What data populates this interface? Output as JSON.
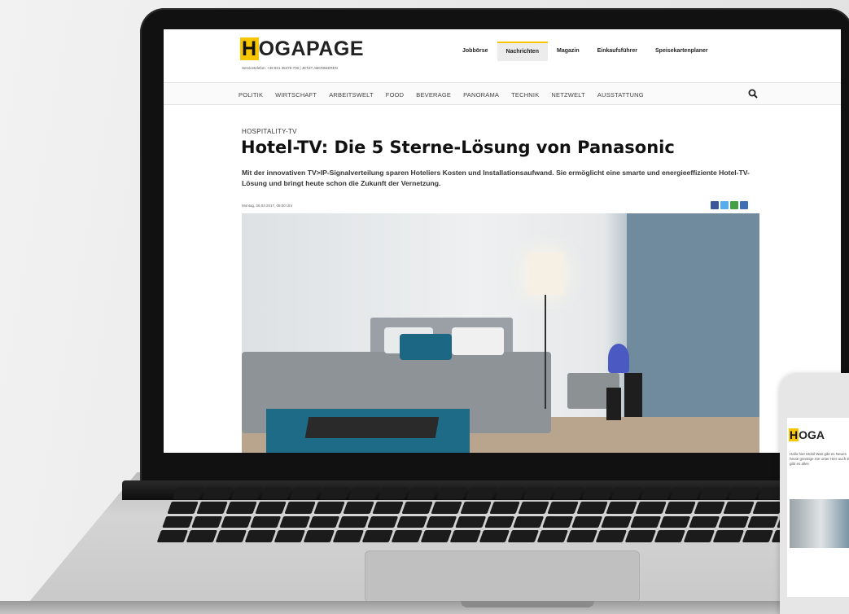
{
  "site": {
    "logo": {
      "first_letter": "H",
      "rest": "OGAPAGE"
    },
    "hotline": "Servicetelefon: +49 821 35475-700  |  JETZT ABONNIEREN",
    "top_nav": [
      {
        "label": "Jobbörse",
        "active": false
      },
      {
        "label": "Nachrichten",
        "active": true
      },
      {
        "label": "Magazin",
        "active": false
      },
      {
        "label": "Einkaufsführer",
        "active": false
      },
      {
        "label": "Speisekartenplaner",
        "active": false
      }
    ],
    "categories": [
      "POLITIK",
      "WIRTSCHAFT",
      "ARBEITSWELT",
      "FOOD",
      "BEVERAGE",
      "PANORAMA",
      "TECHNIK",
      "NETZWELT",
      "AUSSTATTUNG"
    ],
    "search_icon": "search-icon"
  },
  "article": {
    "kicker": "HOSPITALITY-TV",
    "headline": "Hotel-TV: Die 5 Sterne-Lösung von Panasonic",
    "teaser": "Mit der innovativen TV>IP-Signalverteilung sparen Hoteliers Kosten und Installationsaufwand. Sie ermöglicht eine smarte und energieeffiziente Hotel-TV-Lösung und bringt heute schon die Zukunft der Vernetzung.",
    "dateline": "Montag, 06.03.2017, 08:00 Uhr",
    "share_buttons": [
      {
        "name": "facebook-share-icon",
        "color": "#3b5998"
      },
      {
        "name": "twitter-share-icon",
        "color": "#55acee"
      },
      {
        "name": "whatsapp-share-icon",
        "color": "#43a047"
      },
      {
        "name": "email-share-icon",
        "color": "#3f6fb5"
      }
    ]
  },
  "phone": {
    "logo": {
      "first_letter": "H",
      "rest": "OGA"
    },
    "text": "Hallo hier Mobil Was gibt es Neues heute günstige Sie unter Hier auch Es gibt es alles"
  },
  "colors": {
    "brand_yellow": "#f8c600"
  }
}
